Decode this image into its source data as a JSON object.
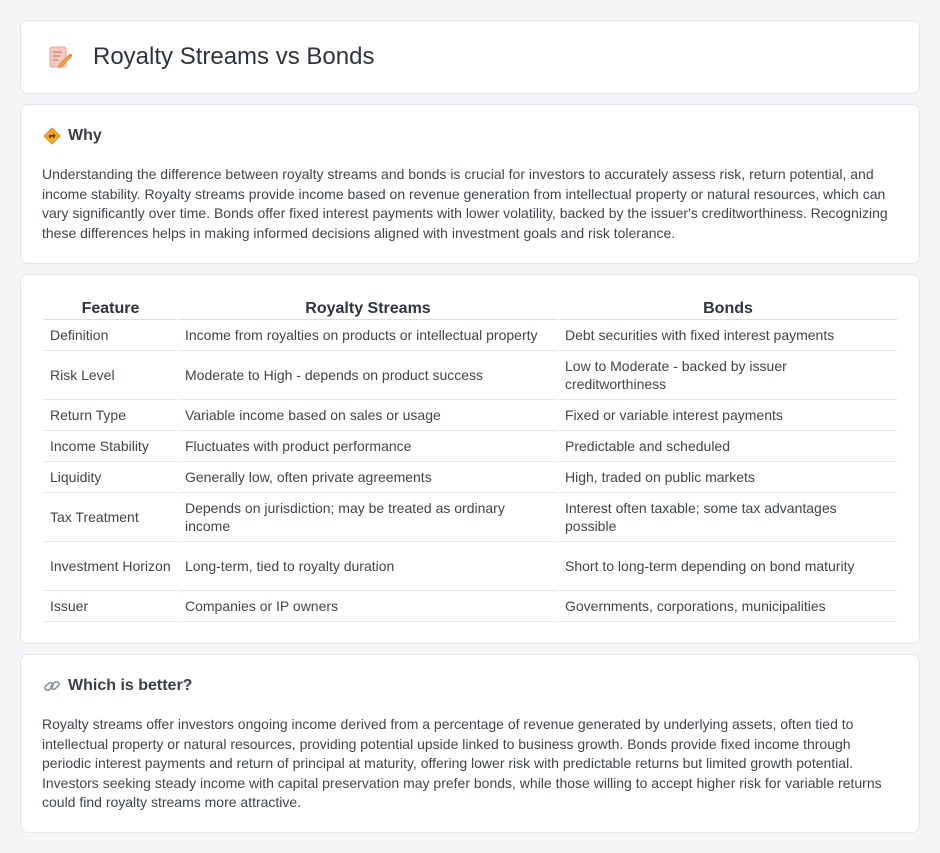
{
  "header": {
    "title": "Royalty Streams vs Bonds",
    "icon": "document-edit-icon"
  },
  "why": {
    "title": "Why",
    "icon": "diamond-sign-icon",
    "text": "Understanding the difference between royalty streams and bonds is crucial for investors to accurately assess risk, return potential, and income stability. Royalty streams provide income based on revenue generation from intellectual property or natural resources, which can vary significantly over time. Bonds offer fixed interest payments with lower volatility, backed by the issuer's creditworthiness. Recognizing these differences helps in making informed decisions aligned with investment goals and risk tolerance."
  },
  "table": {
    "headers": [
      "Feature",
      "Royalty Streams",
      "Bonds"
    ],
    "rows": [
      {
        "feature": "Definition",
        "royalty": "Income from royalties on products or intellectual property",
        "bonds": "Debt securities with fixed interest payments"
      },
      {
        "feature": "Risk Level",
        "royalty": "Moderate to High - depends on product success",
        "bonds": "Low to Moderate - backed by issuer creditworthiness"
      },
      {
        "feature": "Return Type",
        "royalty": "Variable income based on sales or usage",
        "bonds": "Fixed or variable interest payments"
      },
      {
        "feature": "Income Stability",
        "royalty": "Fluctuates with product performance",
        "bonds": "Predictable and scheduled"
      },
      {
        "feature": "Liquidity",
        "royalty": "Generally low, often private agreements",
        "bonds": "High, traded on public markets"
      },
      {
        "feature": "Tax Treatment",
        "royalty": "Depends on jurisdiction; may be treated as ordinary income",
        "bonds": "Interest often taxable; some tax advantages possible"
      },
      {
        "feature": "Investment Horizon",
        "royalty": "Long-term, tied to royalty duration",
        "bonds": "Short to long-term depending on bond maturity"
      },
      {
        "feature": "Issuer",
        "royalty": "Companies or IP owners",
        "bonds": "Governments, corporations, municipalities"
      }
    ]
  },
  "better": {
    "title": "Which is better?",
    "icon": "link-icon",
    "text": "Royalty streams offer investors ongoing income derived from a percentage of revenue generated by underlying assets, often tied to intellectual property or natural resources, providing potential upside linked to business growth. Bonds provide fixed income through periodic interest payments and return of principal at maturity, offering lower risk with predictable returns but limited growth potential. Investors seeking steady income with capital preservation may prefer bonds, while those willing to accept higher risk for variable returns could find royalty streams more attractive."
  }
}
